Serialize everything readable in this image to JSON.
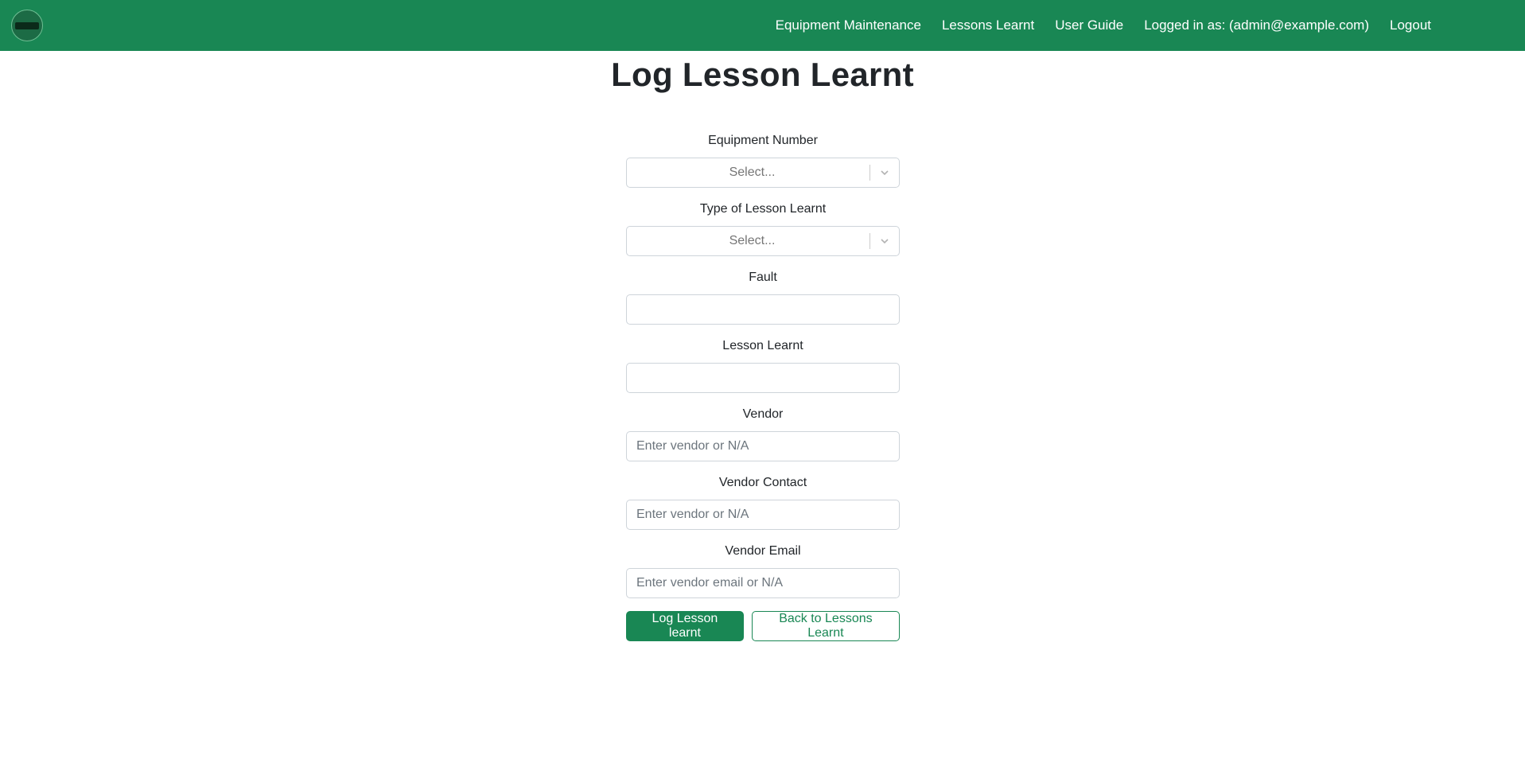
{
  "navbar": {
    "links": {
      "equipment_maintenance": "Equipment Maintenance",
      "lessons_learnt": "Lessons Learnt",
      "user_guide": "User Guide",
      "logout": "Logout"
    },
    "logged_in_text": "Logged in as: (admin@example.com)",
    "background_color": "#198754"
  },
  "page": {
    "title": "Log Lesson Learnt"
  },
  "form": {
    "equipment_number": {
      "label": "Equipment Number",
      "value": "Select..."
    },
    "lesson_type": {
      "label": "Type of Lesson Learnt",
      "value": "Select..."
    },
    "fault": {
      "label": "Fault",
      "value": "",
      "placeholder": ""
    },
    "lesson_learnt": {
      "label": "Lesson Learnt",
      "value": "",
      "placeholder": ""
    },
    "vendor": {
      "label": "Vendor",
      "placeholder": "Enter vendor or N/A"
    },
    "vendor_contact": {
      "label": "Vendor Contact",
      "placeholder": "Enter vendor or N/A"
    },
    "vendor_email": {
      "label": "Vendor Email",
      "placeholder": "Enter vendor email or N/A"
    },
    "submit_label": "Log Lesson learnt",
    "back_label": "Back to Lessons Learnt"
  },
  "icons": {
    "logo": "logo-icon",
    "dropdown": "chevron-down-icon"
  },
  "colors": {
    "accent": "#198754",
    "input_border": "#ced4da"
  }
}
